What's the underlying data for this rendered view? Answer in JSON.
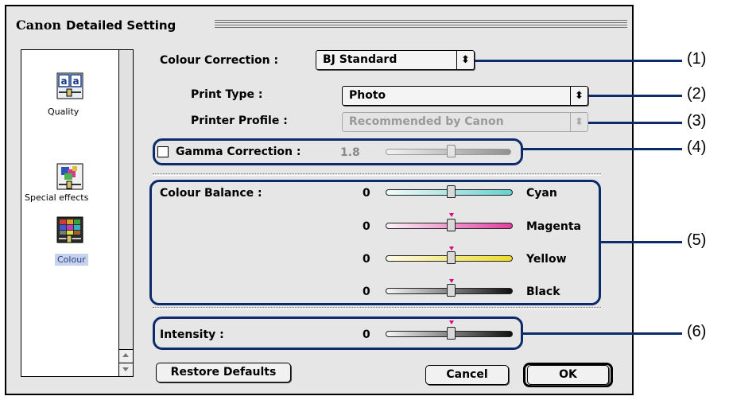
{
  "window": {
    "brand": "Canon",
    "title": "Detailed Setting"
  },
  "sidebar": {
    "items": [
      {
        "label": "Quality",
        "icon": "quality-icon",
        "selected": false
      },
      {
        "label": "Special effects",
        "icon": "special-effects-icon",
        "selected": false
      },
      {
        "label": "Colour",
        "icon": "colour-icon",
        "selected": true
      }
    ]
  },
  "colour_correction": {
    "label": "Colour Correction :",
    "value": "BJ Standard"
  },
  "print_type": {
    "label": "Print Type :",
    "value": "Photo"
  },
  "printer_profile": {
    "label": "Printer Profile :",
    "value": "Recommended by Canon",
    "enabled": false
  },
  "gamma": {
    "label": "Gamma Correction :",
    "value": "1.8",
    "checked": false,
    "level": 0.52
  },
  "colour_balance": {
    "label": "Colour Balance :",
    "sliders": [
      {
        "name": "Cyan",
        "value": "0",
        "level": 0.5
      },
      {
        "name": "Magenta",
        "value": "0",
        "level": 0.5
      },
      {
        "name": "Yellow",
        "value": "0",
        "level": 0.5
      },
      {
        "name": "Black",
        "value": "0",
        "level": 0.5
      }
    ]
  },
  "intensity": {
    "label": "Intensity :",
    "value": "0",
    "level": 0.5
  },
  "buttons": {
    "restore": "Restore Defaults",
    "cancel": "Cancel",
    "ok": "OK"
  },
  "callouts": [
    "(1)",
    "(2)",
    "(3)",
    "(4)",
    "(5)",
    "(6)"
  ],
  "colors": {
    "annotation": "#0d2a6b",
    "tick": "#d60a7a",
    "selected_bg": "#c7d3ec"
  }
}
